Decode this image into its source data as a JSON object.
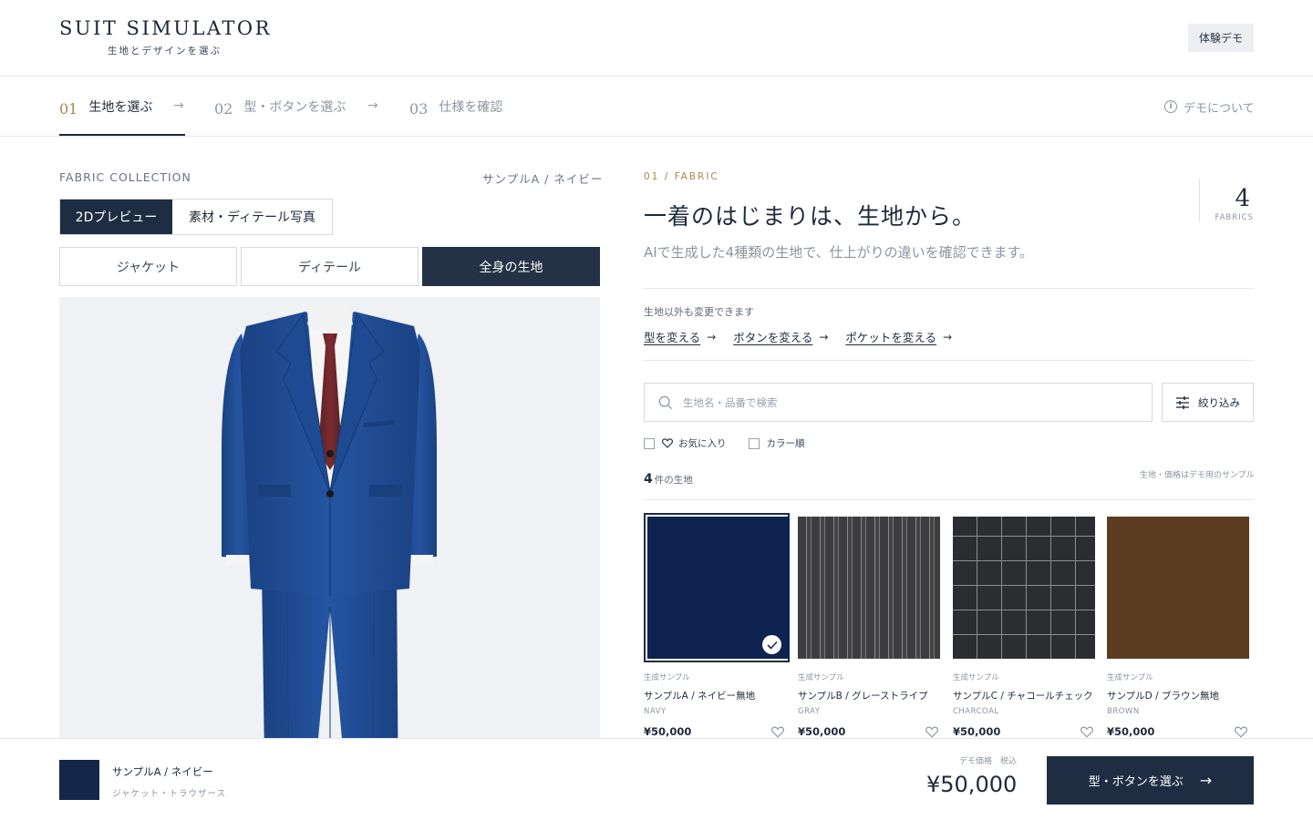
{
  "header": {
    "logo_title": "SUIT SIMULATOR",
    "logo_subtitle": "生地とデザインを選ぶ",
    "demo_badge": "体験デモ"
  },
  "steps": [
    {
      "num": "01",
      "label": "生地を選ぶ",
      "active": true
    },
    {
      "num": "02",
      "label": "型・ボタンを選ぶ",
      "active": false
    },
    {
      "num": "03",
      "label": "仕様を確認",
      "active": false
    }
  ],
  "about_label": "デモについて",
  "left": {
    "collection_label": "FABRIC COLLECTION",
    "selected_label": "サンプルA / ネイビー",
    "view_toggle": [
      "2Dプレビュー",
      "素材・ディテール写真"
    ],
    "part_tabs": [
      "ジャケット",
      "ディテール",
      "全身の生地"
    ],
    "active_part": 2
  },
  "right": {
    "eyebrow": "01 / FABRIC",
    "headline": "一着のはじまりは、生地から。",
    "subtitle": "AIで生成した4種類の生地で、仕上がりの違いを確認できます。",
    "count": "4",
    "count_label": "FABRICS",
    "change_note": "生地以外も変更できます",
    "change_links": [
      "型を変える",
      "ボタンを変える",
      "ポケットを変える"
    ],
    "search_placeholder": "生地名・品番で検索",
    "filter_label": "絞り込み",
    "check_favorites": "お気に入り",
    "check_color_sort": "カラー順",
    "result_count": "4",
    "result_unit": "件の生地",
    "result_note": "生地・価格はデモ用のサンプル"
  },
  "fabrics": [
    {
      "tag": "生成サンプル",
      "name": "サンプルA / ネイビー無地",
      "color": "NAVY",
      "price": "¥50,000",
      "swatch": "#0f2350",
      "selected": true
    },
    {
      "tag": "生成サンプル",
      "name": "サンプルB / グレーストライプ",
      "color": "GRAY",
      "price": "¥50,000",
      "swatch": "#3f3f42",
      "selected": false
    },
    {
      "tag": "生成サンプル",
      "name": "サンプルC / チャコールチェック",
      "color": "CHARCOAL",
      "price": "¥50,000",
      "swatch": "#2c2e31",
      "selected": false
    },
    {
      "tag": "生成サンプル",
      "name": "サンプルD / ブラウン無地",
      "color": "BROWN",
      "price": "¥50,000",
      "swatch": "#5c3d22",
      "selected": false
    }
  ],
  "bottom": {
    "selected_name": "サンプルA / ネイビー",
    "selected_parts": "ジャケット・トラウザース",
    "price_note": "デモ価格　税込",
    "price": "¥50,000",
    "next_label": "型・ボタンを選ぶ"
  },
  "colors": {
    "navy_dark": "#1f2d42",
    "gold_accent": "#a88654",
    "suit_blue": "#1f4c8f"
  }
}
